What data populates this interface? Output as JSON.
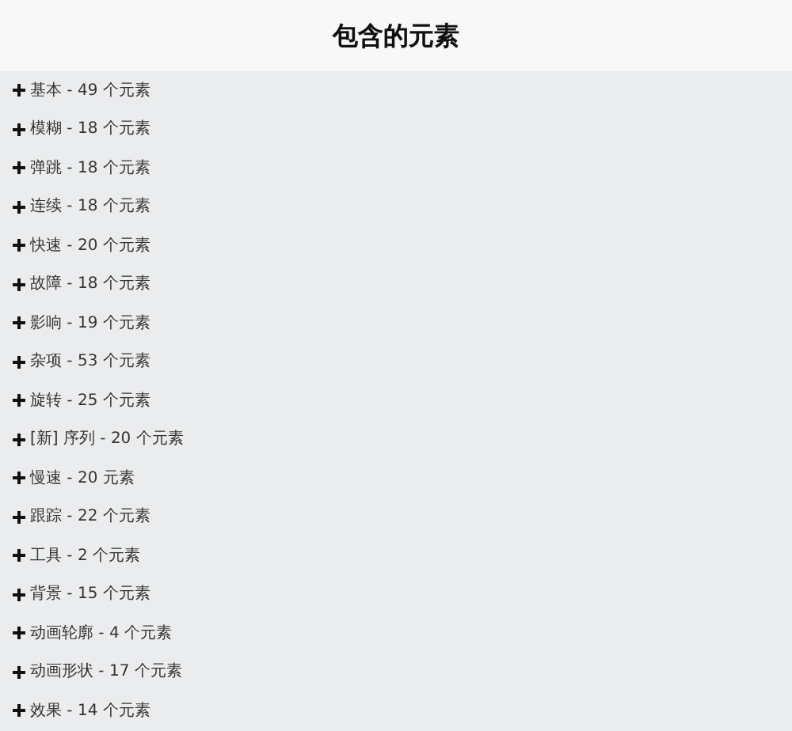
{
  "title": "包含的元素",
  "groups": [
    {
      "label": "基本 - 49 个元素",
      "expanded": false
    },
    {
      "label": "模糊 - 18 个元素",
      "expanded": false
    },
    {
      "label": "弹跳 - 18 个元素",
      "expanded": false
    },
    {
      "label": "连续 - 18 个元素",
      "expanded": false
    },
    {
      "label": "快速 - 20 个元素",
      "expanded": false
    },
    {
      "label": "故障 - 18 个元素",
      "expanded": false
    },
    {
      "label": "影响 - 19 个元素",
      "expanded": false
    },
    {
      "label": "杂项 - 53 个元素",
      "expanded": false
    },
    {
      "label": "旋转 - 25 个元素",
      "expanded": false
    },
    {
      "label": "[新] 序列 - 20 个元素",
      "expanded": false
    },
    {
      "label": "慢速 - 20 元素",
      "expanded": false
    },
    {
      "label": "跟踪 - 22 个元素",
      "expanded": false
    },
    {
      "label": "工具 - 2 个元素",
      "expanded": false
    },
    {
      "label": "背景 - 15 个元素",
      "expanded": false
    },
    {
      "label": "动画轮廓 - 4 个元素",
      "expanded": false
    },
    {
      "label": "动画形状 - 17 个元素",
      "expanded": false
    },
    {
      "label": "效果 - 14 个元素",
      "expanded": false
    }
  ]
}
